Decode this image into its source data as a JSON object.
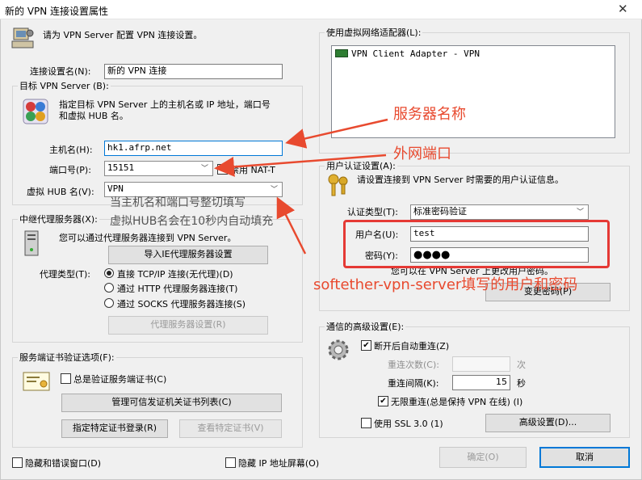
{
  "window": {
    "title": "新的 VPN 连接设置属性",
    "close": "✕"
  },
  "intro": "请为 VPN Server 配置 VPN 连接设置。",
  "conn_name": {
    "label": "连接设置名(N):",
    "value": "新的 VPN 连接"
  },
  "target": {
    "legend": "目标 VPN Server (B):",
    "desc_line1": "指定目标 VPN Server 上的主机名或 IP 地址，端口号",
    "desc_line2": "和虚拟 HUB 名。",
    "host_label": "主机名(H):",
    "host_value": "hk1.afrp.net",
    "port_label": "端口号(P):",
    "port_value": "15151",
    "natt_label": "禁用 NAT-T",
    "hub_label": "虚拟 HUB 名(V):",
    "hub_value": "VPN"
  },
  "adapter": {
    "legend": "使用虚拟网络适配器(L):",
    "items": [
      "VPN Client Adapter - VPN"
    ]
  },
  "proxy": {
    "legend": "中继代理服务器(X):",
    "desc": "您可以通过代理服务器连接到 VPN Server。",
    "import_btn": "导入IE代理服务器设置",
    "type_label": "代理类型(T):",
    "options": [
      "直接 TCP/IP 连接(无代理)(D)",
      "通过 HTTP 代理服务器连接(T)",
      "通过 SOCKS 代理服务器连接(S)"
    ],
    "settings_btn": "代理服务器设置(R)"
  },
  "cert": {
    "legend": "服务端证书验证选项(F):",
    "always_verify": "总是验证服务端证书(C)",
    "manage_btn": "管理可信发证机关证书列表(C)",
    "specify_btn": "指定特定证书登录(R)",
    "view_btn": "查看特定证书(V)"
  },
  "auth": {
    "legend": "用户认证设置(A):",
    "desc": "请设置连接到 VPN Server 时需要的用户认证信息。",
    "type_label": "认证类型(T):",
    "type_value": "标准密码验证",
    "user_label": "用户名(U):",
    "user_value": "test",
    "pass_label": "密码(Y):",
    "pass_value": "●●●●",
    "hint": "您可以在 VPN Server 上更改用户密码。",
    "change_btn": "变更密码(P)"
  },
  "advanced": {
    "legend": "通信的高级设置(E):",
    "auto_reconnect": "断开后自动重连(Z)",
    "retry_count_label": "重连次数(C):",
    "retry_count_unit": "次",
    "retry_interval_label": "重连间隔(K):",
    "retry_interval_value": "15",
    "retry_interval_unit": "秒",
    "infinite": "无限重连(总是保持 VPN 在线) (I)",
    "ssl3": "使用 SSL 3.0 (1)",
    "adv_btn": "高级设置(D)..."
  },
  "footer": {
    "hide_status": "隐藏和错误窗口(D)",
    "hide_ip": "隐藏 IP 地址屏幕(O)",
    "ok": "确定(O)",
    "cancel": "取消"
  },
  "annotations": {
    "server_name": "服务器名称",
    "wan_port": "外网端口",
    "paste_note_1": "当主机名和端口号整切填写",
    "paste_note_2": "虚拟HUB名会在10秒内自动填充",
    "cred_note": "softether-vpn-server填写的用户和密码"
  },
  "colors": {
    "annotation": "#e84a2f",
    "highlight_box": "#e53935",
    "focus": "#0078d7"
  }
}
